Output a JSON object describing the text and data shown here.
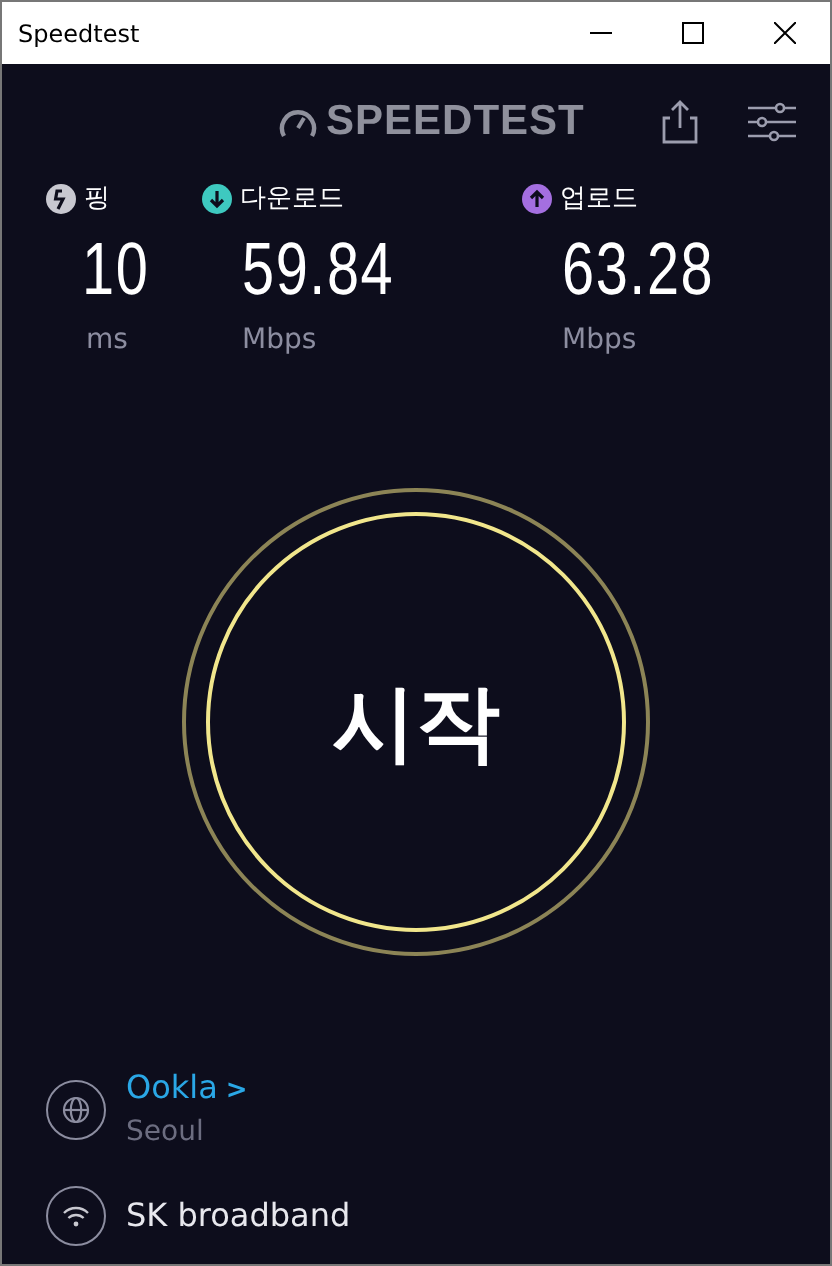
{
  "window": {
    "title": "Speedtest"
  },
  "logo": {
    "text": "SPEEDTEST"
  },
  "metrics": [
    {
      "kind": "ping",
      "label": "핑",
      "value": "10",
      "unit": "ms",
      "color": "#c8c8d0"
    },
    {
      "kind": "download",
      "label": "다운로드",
      "value": "59.84",
      "unit": "Mbps",
      "color": "#3ec9c0"
    },
    {
      "kind": "upload",
      "label": "업로드",
      "value": "63.28",
      "unit": "Mbps",
      "color": "#a46fe0"
    }
  ],
  "start_button": {
    "label": "시작"
  },
  "server": {
    "name": "Ookla",
    "chevron": ">",
    "location": "Seoul"
  },
  "provider": {
    "name": "SK broadband"
  }
}
